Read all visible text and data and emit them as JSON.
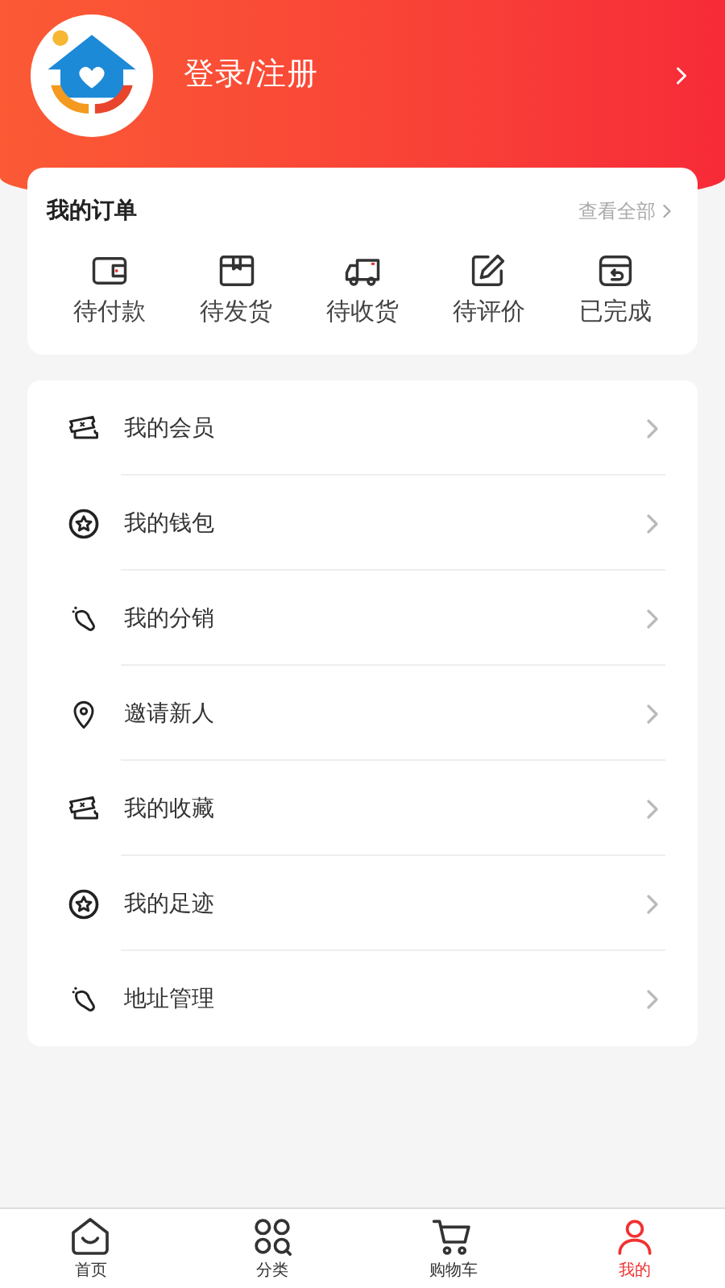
{
  "header": {
    "login": "登录/注册"
  },
  "orders": {
    "title": "我的订单",
    "view_all": "查看全部",
    "items": [
      {
        "label": "待付款"
      },
      {
        "label": "待发货"
      },
      {
        "label": "待收货"
      },
      {
        "label": "待评价"
      },
      {
        "label": "已完成"
      }
    ]
  },
  "menu": [
    {
      "label": "我的会员"
    },
    {
      "label": "我的钱包"
    },
    {
      "label": "我的分销"
    },
    {
      "label": "邀请新人"
    },
    {
      "label": "我的收藏"
    },
    {
      "label": "我的足迹"
    },
    {
      "label": "地址管理"
    }
  ],
  "tabbar": [
    {
      "label": "首页",
      "selected": false
    },
    {
      "label": "分类",
      "selected": false
    },
    {
      "label": "购物车",
      "selected": false
    },
    {
      "label": "我的",
      "selected": true
    }
  ]
}
